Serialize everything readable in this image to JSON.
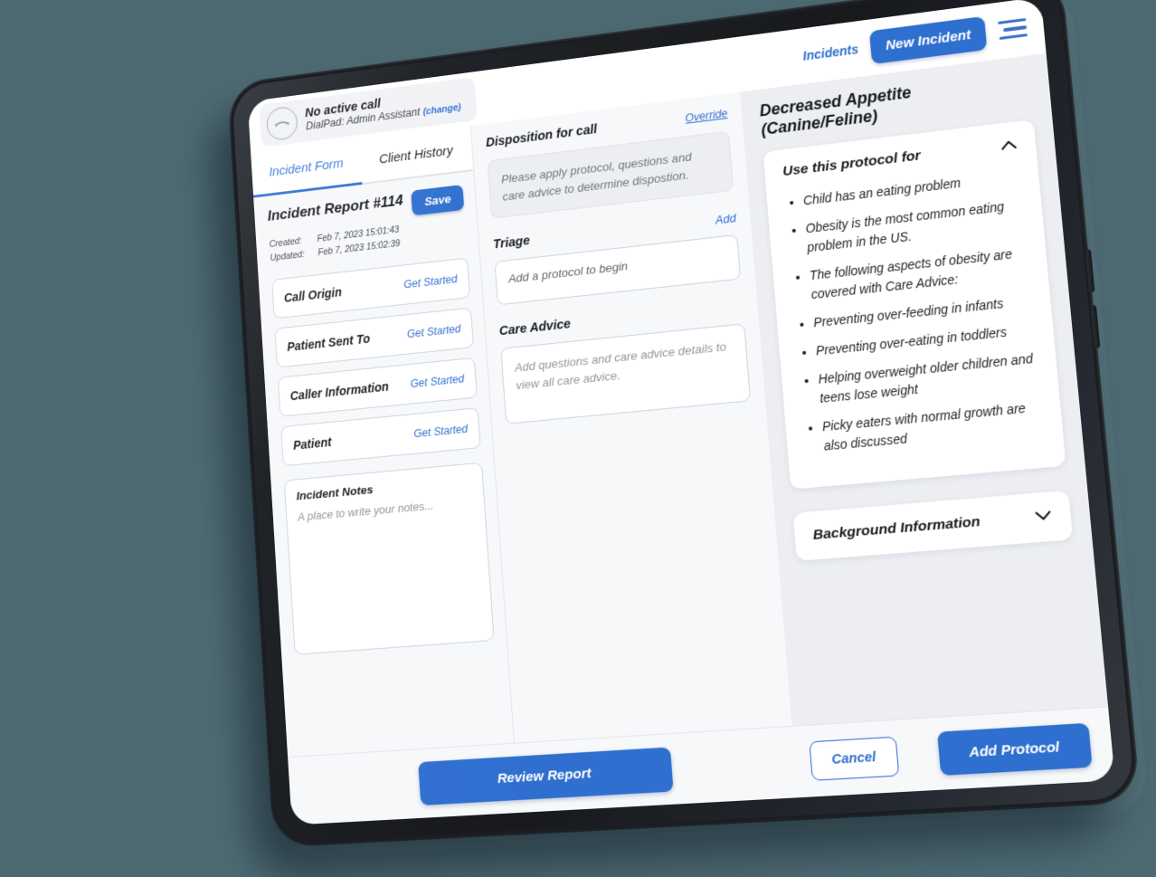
{
  "topbar": {
    "call_status": "No active call",
    "call_source": "DialPad: Admin Assistant",
    "call_change_link": "(change)",
    "incidents_link": "Incidents",
    "new_incident_button": "New Incident"
  },
  "tabs": [
    {
      "label": "Incident Form",
      "active": true
    },
    {
      "label": "Client History",
      "active": false
    }
  ],
  "report": {
    "title": "Incident Report #114",
    "save_button": "Save",
    "created_label": "Created:",
    "created_value": "Feb 7, 2023 15:01:43",
    "updated_label": "Updated:",
    "updated_value": "Feb 7, 2023 15:02:39"
  },
  "form_rows": [
    {
      "label": "Call Origin",
      "action": "Get Started"
    },
    {
      "label": "Patient Sent To",
      "action": "Get Started"
    },
    {
      "label": "Caller Information",
      "action": "Get Started"
    },
    {
      "label": "Patient",
      "action": "Get Started"
    }
  ],
  "notes": {
    "title": "Incident Notes",
    "placeholder": "A place to write your notes..."
  },
  "disposition": {
    "title": "Disposition for call",
    "override_link": "Override",
    "text": "Please apply protocol, questions and care advice to determine dispostion."
  },
  "triage": {
    "title": "Triage",
    "add_link": "Add",
    "placeholder": "Add a protocol to begin"
  },
  "care_advice": {
    "title": "Care Advice",
    "placeholder": "Add questions and care advice details to view all care advice."
  },
  "protocol": {
    "title": "Decreased Appetite (Canine/Feline)",
    "use_for": {
      "title": "Use this protocol for",
      "chevron": "expanded",
      "bullets": [
        "Child has an eating problem",
        "Obesity is the most common eating problem in the US.",
        "The following aspects of obesity are covered with Care Advice:",
        "Preventing over-feeding in infants",
        "Preventing over-eating in toddlers",
        "Helping overweight older children and teens lose weight",
        "Picky eaters with normal growth are also discussed"
      ]
    },
    "background": {
      "title": "Background Information",
      "chevron": "collapsed"
    }
  },
  "footer": {
    "review_report_button": "Review Report",
    "cancel_button": "Cancel",
    "add_protocol_button": "Add Protocol"
  },
  "colors": {
    "accent_blue": "#2f6fd0",
    "page_background": "#4d6a73",
    "panel_gray": "#eceef2"
  }
}
